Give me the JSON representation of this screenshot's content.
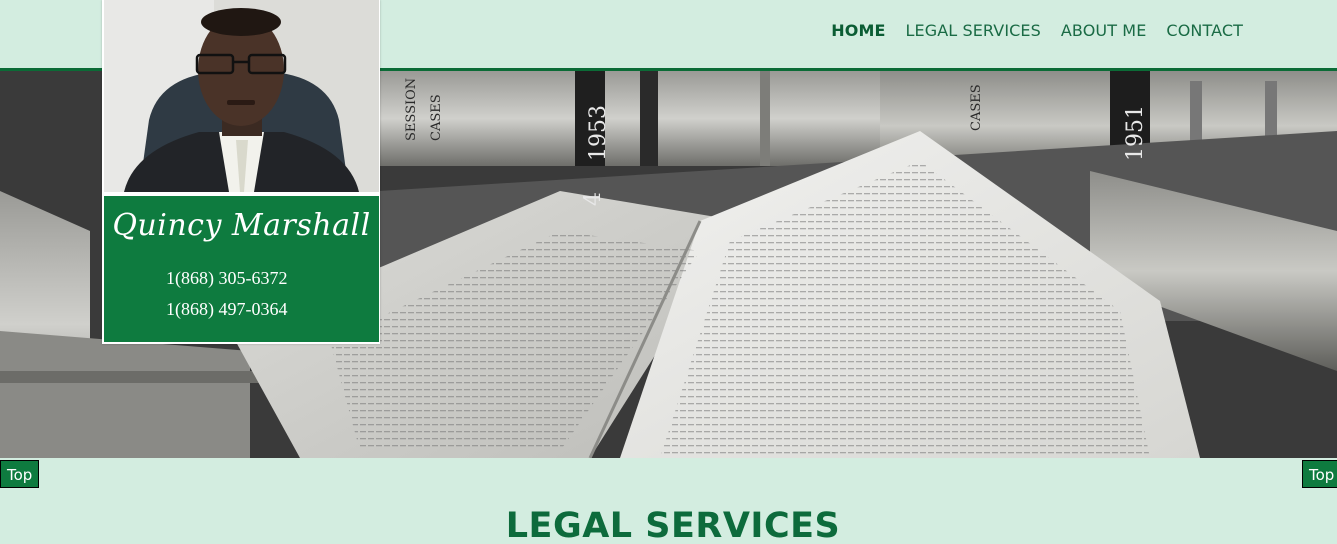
{
  "nav": {
    "items": [
      {
        "label": "HOME",
        "active": true
      },
      {
        "label": "LEGAL SERVICES",
        "active": false
      },
      {
        "label": "ABOUT ME",
        "active": false
      },
      {
        "label": "CONTACT",
        "active": false
      }
    ]
  },
  "profile": {
    "name": "Quincy Marshall",
    "phones": [
      "1(868) 305-6372",
      "1(868) 497-0364"
    ]
  },
  "hero": {
    "image": "open-law-book-photo",
    "spine_texts": [
      "SESSION",
      "CASES",
      "1953",
      "1951",
      "CASES",
      "4"
    ]
  },
  "buttons": {
    "top_left": "Top",
    "top_right": "Top"
  },
  "section": {
    "title": "LEGAL SERVICES"
  },
  "colors": {
    "background": "#d3ede0",
    "accent": "#0e7b3f",
    "nav_text": "#1a6b45"
  }
}
